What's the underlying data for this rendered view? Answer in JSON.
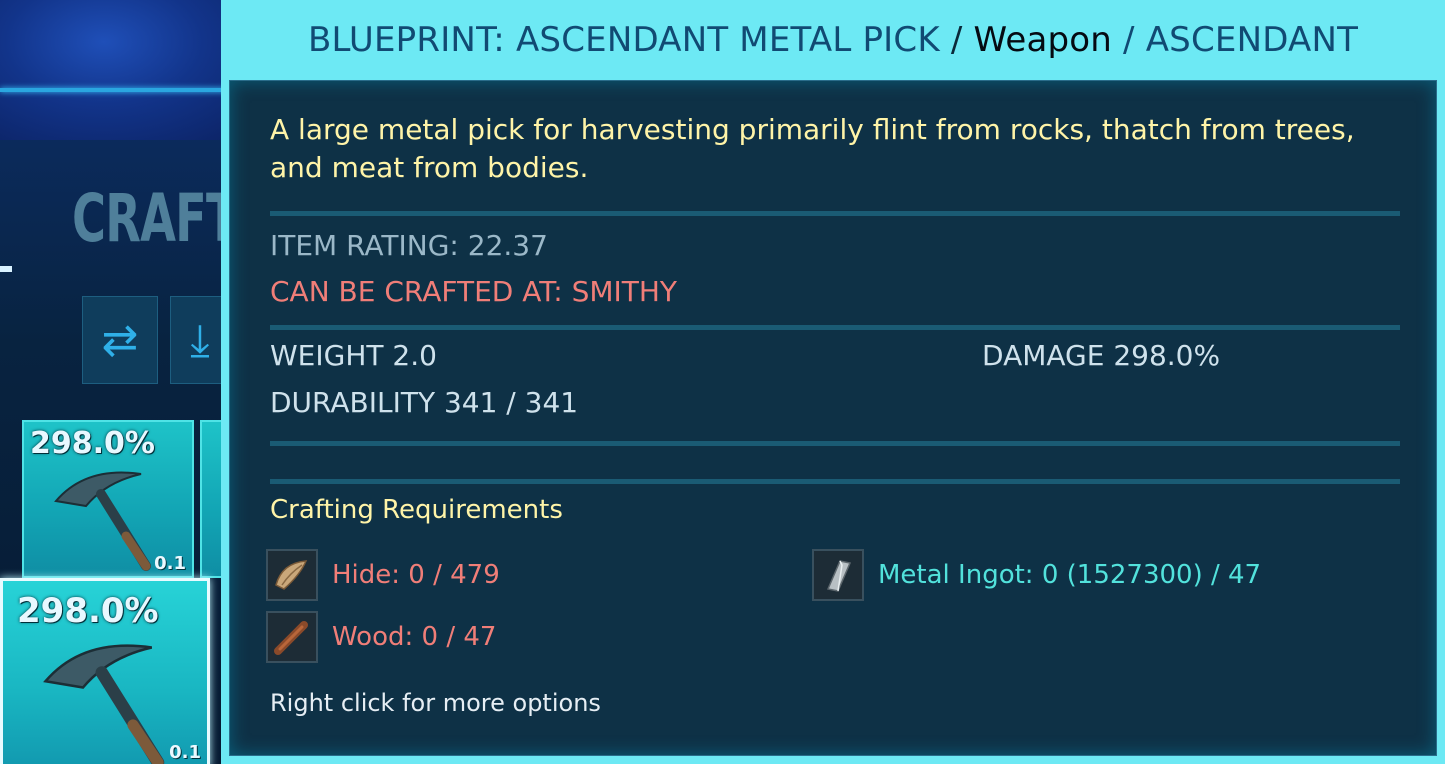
{
  "background": {
    "section_label": "CRAFT",
    "slots": [
      {
        "durability_pct": "298.0%",
        "quantity": "0.1"
      },
      {
        "durability_pct": "298.0%",
        "quantity": "0.1"
      }
    ]
  },
  "tooltip": {
    "header": {
      "item_name": "BLUEPRINT: ASCENDANT METAL PICK",
      "separator1": " / ",
      "item_type": "Weapon",
      "separator2": " / ",
      "quality": "ASCENDANT"
    },
    "description": "A large metal pick for harvesting primarily flint from rocks, thatch from trees, and meat from bodies.",
    "item_rating": "ITEM RATING: 22.37",
    "crafted_at": "CAN BE CRAFTED AT: SMITHY",
    "stats": {
      "weight": "WEIGHT 2.0",
      "damage": "DAMAGE 298.0%",
      "durability": "DURABILITY 341 / 341"
    },
    "requirements_title": "Crafting Requirements",
    "requirements": [
      {
        "label": "Hide: 0 / 479",
        "icon": "hide-icon",
        "satisfied": false
      },
      {
        "label": "Wood: 0 / 47",
        "icon": "wood-icon",
        "satisfied": false
      },
      {
        "label": "Metal Ingot: 0 (1527300) / 47",
        "icon": "metal-ingot-icon",
        "satisfied": true
      }
    ],
    "hint": "Right click for more options"
  },
  "colors": {
    "header_bg": "#6de9f4",
    "body_bg": "#062238",
    "description": "#fff4a8",
    "missing": "#f07e78",
    "available": "#52e2dc"
  }
}
